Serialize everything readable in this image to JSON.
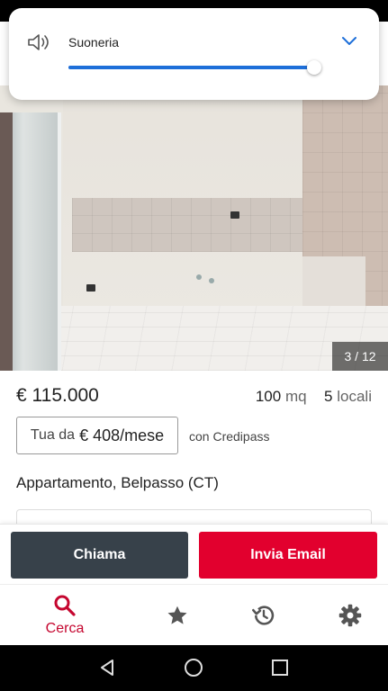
{
  "volume": {
    "label": "Suoneria",
    "level": 0.99,
    "icons": {
      "speaker": "speaker-icon",
      "expand": "chevron-down-icon"
    },
    "accent_color": "#1e6fd9"
  },
  "gallery": {
    "counter": "3 / 12"
  },
  "listing": {
    "price": "€ 115.000",
    "area_value": "100",
    "area_unit": "mq",
    "rooms_value": "5",
    "rooms_unit": "locali",
    "credipass": {
      "prefix": "Tua da",
      "amount": "€ 408/mese",
      "note": "con Credipass"
    },
    "location": "Appartamento, Belpasso (CT)"
  },
  "actions": {
    "call_label": "Chiama",
    "email_label": "Invia Email",
    "call_color": "#37414a",
    "email_color": "#e2002e"
  },
  "bottom_nav": {
    "search_label": "Cerca",
    "active_color": "#c5062f",
    "icons": [
      "search-icon",
      "star-icon",
      "history-icon",
      "gear-icon"
    ]
  },
  "system_nav": {
    "icons": [
      "back-icon",
      "home-icon",
      "recents-icon"
    ]
  }
}
